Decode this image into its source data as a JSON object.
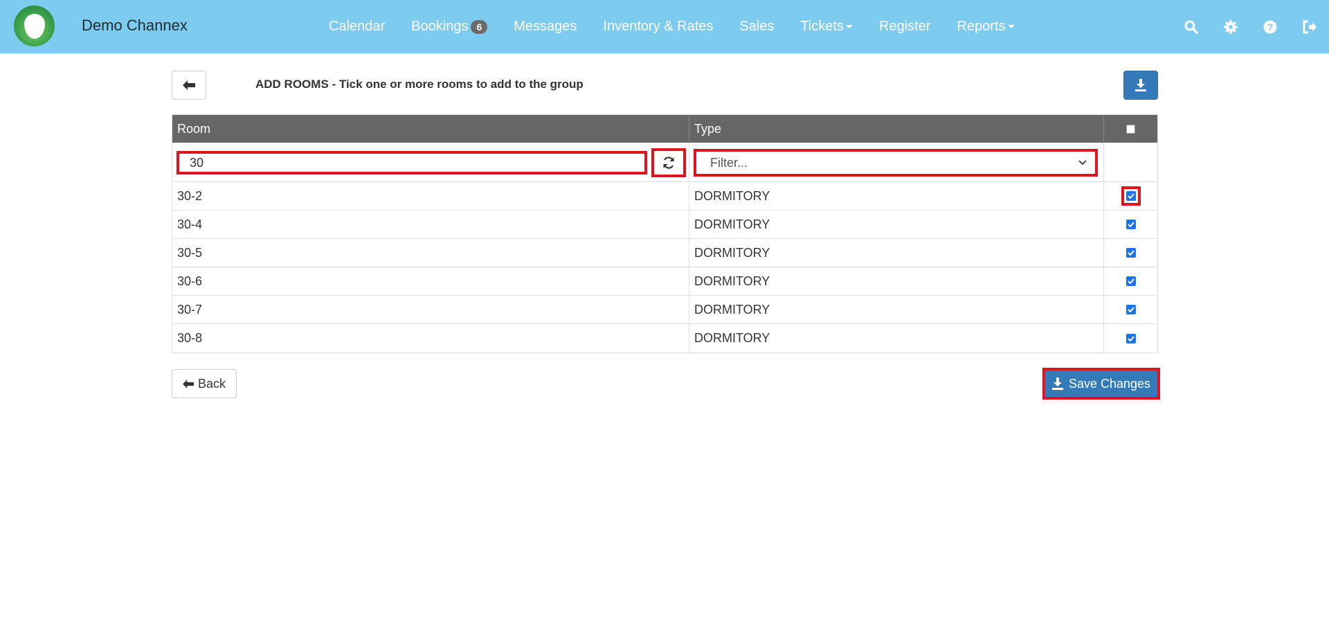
{
  "app": {
    "brand": "Demo Channex"
  },
  "nav": {
    "items": [
      {
        "label": "Calendar"
      },
      {
        "label": "Bookings",
        "badge": "6"
      },
      {
        "label": "Messages"
      },
      {
        "label": "Inventory & Rates"
      },
      {
        "label": "Sales"
      },
      {
        "label": "Tickets",
        "dropdown": true
      },
      {
        "label": "Register"
      },
      {
        "label": "Reports",
        "dropdown": true
      }
    ],
    "icons": [
      "search-icon",
      "gear-icon",
      "help-icon",
      "logout-icon"
    ]
  },
  "page": {
    "title": "ADD ROOMS - Tick one or more rooms to add to the group"
  },
  "table": {
    "headers": {
      "room": "Room",
      "type": "Type"
    },
    "filter": {
      "room_value": "30",
      "type_placeholder": "Filter..."
    },
    "rows": [
      {
        "room": "30-2",
        "type": "DORMITORY",
        "checked": true
      },
      {
        "room": "30-4",
        "type": "DORMITORY",
        "checked": true
      },
      {
        "room": "30-5",
        "type": "DORMITORY",
        "checked": true
      },
      {
        "room": "30-6",
        "type": "DORMITORY",
        "checked": true
      },
      {
        "room": "30-7",
        "type": "DORMITORY",
        "checked": true
      },
      {
        "room": "30-8",
        "type": "DORMITORY",
        "checked": true
      }
    ]
  },
  "buttons": {
    "back_label": "Back",
    "save_label": "Save Changes"
  },
  "colors": {
    "navbar": "#7dcbee",
    "primary": "#337ab7",
    "highlight": "#e0141e",
    "header": "#666666"
  }
}
